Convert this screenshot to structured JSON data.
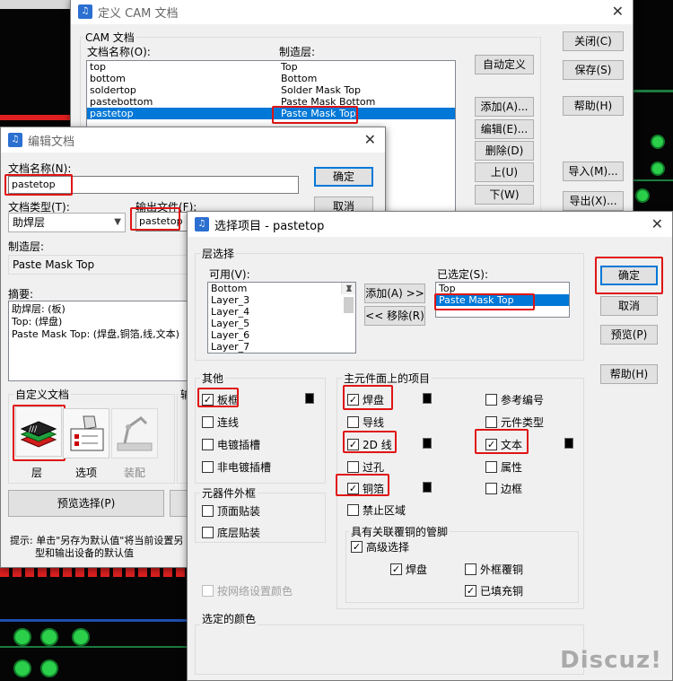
{
  "cam": {
    "title": "定义 CAM 文档",
    "group": "CAM 文档",
    "col_name": "文档名称(O):",
    "col_layer": "制造层:",
    "rows": [
      {
        "name": "top",
        "layer": "Top"
      },
      {
        "name": "bottom",
        "layer": "Bottom"
      },
      {
        "name": "soldertop",
        "layer": "Solder Mask Top"
      },
      {
        "name": "pastebottom",
        "layer": "Paste Mask Bottom"
      },
      {
        "name": "pastetop",
        "layer": "Paste Mask Top"
      }
    ],
    "buttons": [
      "自动定义",
      "添加(A)...",
      "编辑(E)...",
      "删除(D)",
      "上(U)",
      "下(W)"
    ],
    "right_buttons": [
      "关闭(C)",
      "保存(S)",
      "帮助(H)",
      "导入(M)...",
      "导出(X)..."
    ]
  },
  "edit": {
    "title": "编辑文档",
    "doc_name_label": "文档名称(N):",
    "doc_name": "pastetop",
    "ok": "确定",
    "cancel": "取消",
    "doc_type_label": "文档类型(T):",
    "doc_type": "助焊层",
    "output_label": "输出文件(F):",
    "output": "pastetop",
    "layer_label": "制造层:",
    "layer": "Paste Mask Top",
    "summary_label": "摘要:",
    "summary": [
      "助焊层: (板)",
      "Top: (焊盘)",
      "Paste Mask Top: (焊盘,铜箔,线,文本)"
    ],
    "custom_label": "自定义文档",
    "icons": [
      "层",
      "选项",
      "装配"
    ],
    "preview": "预览选择(P)",
    "tip": "提示: 单击\"另存为默认值\"将当前设置另",
    "tip2": "型和输出设备的默认值"
  },
  "sel": {
    "title": "选择项目 - pastetop",
    "layer_group": "层选择",
    "avail_label": "可用(V):",
    "avail": [
      "Bottom",
      "Layer_3",
      "Layer_4",
      "Layer_5",
      "Layer_6",
      "Layer_7"
    ],
    "add": "添加(A) >>",
    "remove": "<< 移除(R)",
    "selected_label": "已选定(S):",
    "selected": [
      "Top",
      "Paste Mask Top"
    ],
    "ok": "确定",
    "cancel": "取消",
    "preview": "预览(P)",
    "help": "帮助(H)",
    "other_group": "其他",
    "other": [
      {
        "label": "板框",
        "checked": true
      },
      {
        "label": "连线",
        "checked": false
      },
      {
        "label": "电镀插槽",
        "checked": false
      },
      {
        "label": "非电镀插槽",
        "checked": false
      }
    ],
    "outline_group": "元器件外框",
    "outline": [
      {
        "label": "顶面贴装",
        "checked": false
      },
      {
        "label": "底层贴装",
        "checked": false
      }
    ],
    "net_color": "按网络设置颜色",
    "main_group": "主元件面上的项目",
    "main_left": [
      {
        "label": "焊盘",
        "checked": true
      },
      {
        "label": "导线",
        "checked": false
      },
      {
        "label": "2D 线",
        "checked": true
      },
      {
        "label": "过孔",
        "checked": false
      },
      {
        "label": "铜箔",
        "checked": true
      },
      {
        "label": "禁止区域",
        "checked": false
      }
    ],
    "main_right": [
      {
        "label": "参考编号",
        "checked": false
      },
      {
        "label": "元件类型",
        "checked": false
      },
      {
        "label": "文本",
        "checked": true
      },
      {
        "label": "属性",
        "checked": false
      },
      {
        "label": "边框",
        "checked": false
      }
    ],
    "pour_group": "具有关联覆铜的管脚",
    "pour": [
      {
        "label": "高级选择",
        "checked": true
      },
      {
        "label": "焊盘",
        "checked": true
      },
      {
        "label": "外框覆铜",
        "checked": false
      },
      {
        "label": "已填充铜",
        "checked": true
      }
    ],
    "color_group": "选定的颜色"
  },
  "watermark": "Discuz!"
}
